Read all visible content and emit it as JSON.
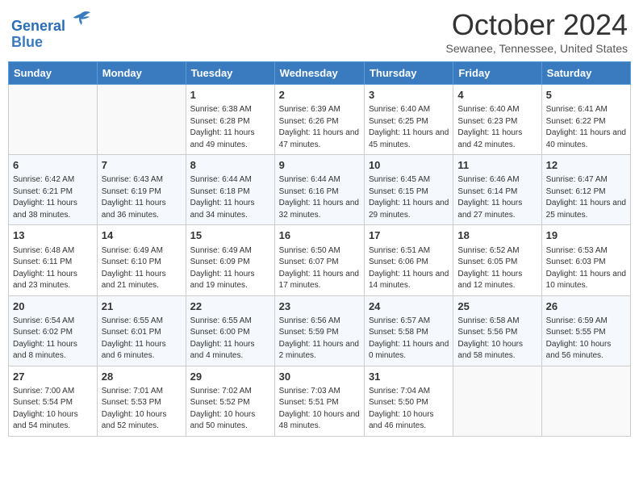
{
  "header": {
    "logo_line1": "General",
    "logo_line2": "Blue",
    "month_title": "October 2024",
    "location": "Sewanee, Tennessee, United States"
  },
  "days_of_week": [
    "Sunday",
    "Monday",
    "Tuesday",
    "Wednesday",
    "Thursday",
    "Friday",
    "Saturday"
  ],
  "weeks": [
    [
      {
        "day": "",
        "info": ""
      },
      {
        "day": "",
        "info": ""
      },
      {
        "day": "1",
        "info": "Sunrise: 6:38 AM\nSunset: 6:28 PM\nDaylight: 11 hours and 49 minutes."
      },
      {
        "day": "2",
        "info": "Sunrise: 6:39 AM\nSunset: 6:26 PM\nDaylight: 11 hours and 47 minutes."
      },
      {
        "day": "3",
        "info": "Sunrise: 6:40 AM\nSunset: 6:25 PM\nDaylight: 11 hours and 45 minutes."
      },
      {
        "day": "4",
        "info": "Sunrise: 6:40 AM\nSunset: 6:23 PM\nDaylight: 11 hours and 42 minutes."
      },
      {
        "day": "5",
        "info": "Sunrise: 6:41 AM\nSunset: 6:22 PM\nDaylight: 11 hours and 40 minutes."
      }
    ],
    [
      {
        "day": "6",
        "info": "Sunrise: 6:42 AM\nSunset: 6:21 PM\nDaylight: 11 hours and 38 minutes."
      },
      {
        "day": "7",
        "info": "Sunrise: 6:43 AM\nSunset: 6:19 PM\nDaylight: 11 hours and 36 minutes."
      },
      {
        "day": "8",
        "info": "Sunrise: 6:44 AM\nSunset: 6:18 PM\nDaylight: 11 hours and 34 minutes."
      },
      {
        "day": "9",
        "info": "Sunrise: 6:44 AM\nSunset: 6:16 PM\nDaylight: 11 hours and 32 minutes."
      },
      {
        "day": "10",
        "info": "Sunrise: 6:45 AM\nSunset: 6:15 PM\nDaylight: 11 hours and 29 minutes."
      },
      {
        "day": "11",
        "info": "Sunrise: 6:46 AM\nSunset: 6:14 PM\nDaylight: 11 hours and 27 minutes."
      },
      {
        "day": "12",
        "info": "Sunrise: 6:47 AM\nSunset: 6:12 PM\nDaylight: 11 hours and 25 minutes."
      }
    ],
    [
      {
        "day": "13",
        "info": "Sunrise: 6:48 AM\nSunset: 6:11 PM\nDaylight: 11 hours and 23 minutes."
      },
      {
        "day": "14",
        "info": "Sunrise: 6:49 AM\nSunset: 6:10 PM\nDaylight: 11 hours and 21 minutes."
      },
      {
        "day": "15",
        "info": "Sunrise: 6:49 AM\nSunset: 6:09 PM\nDaylight: 11 hours and 19 minutes."
      },
      {
        "day": "16",
        "info": "Sunrise: 6:50 AM\nSunset: 6:07 PM\nDaylight: 11 hours and 17 minutes."
      },
      {
        "day": "17",
        "info": "Sunrise: 6:51 AM\nSunset: 6:06 PM\nDaylight: 11 hours and 14 minutes."
      },
      {
        "day": "18",
        "info": "Sunrise: 6:52 AM\nSunset: 6:05 PM\nDaylight: 11 hours and 12 minutes."
      },
      {
        "day": "19",
        "info": "Sunrise: 6:53 AM\nSunset: 6:03 PM\nDaylight: 11 hours and 10 minutes."
      }
    ],
    [
      {
        "day": "20",
        "info": "Sunrise: 6:54 AM\nSunset: 6:02 PM\nDaylight: 11 hours and 8 minutes."
      },
      {
        "day": "21",
        "info": "Sunrise: 6:55 AM\nSunset: 6:01 PM\nDaylight: 11 hours and 6 minutes."
      },
      {
        "day": "22",
        "info": "Sunrise: 6:55 AM\nSunset: 6:00 PM\nDaylight: 11 hours and 4 minutes."
      },
      {
        "day": "23",
        "info": "Sunrise: 6:56 AM\nSunset: 5:59 PM\nDaylight: 11 hours and 2 minutes."
      },
      {
        "day": "24",
        "info": "Sunrise: 6:57 AM\nSunset: 5:58 PM\nDaylight: 11 hours and 0 minutes."
      },
      {
        "day": "25",
        "info": "Sunrise: 6:58 AM\nSunset: 5:56 PM\nDaylight: 10 hours and 58 minutes."
      },
      {
        "day": "26",
        "info": "Sunrise: 6:59 AM\nSunset: 5:55 PM\nDaylight: 10 hours and 56 minutes."
      }
    ],
    [
      {
        "day": "27",
        "info": "Sunrise: 7:00 AM\nSunset: 5:54 PM\nDaylight: 10 hours and 54 minutes."
      },
      {
        "day": "28",
        "info": "Sunrise: 7:01 AM\nSunset: 5:53 PM\nDaylight: 10 hours and 52 minutes."
      },
      {
        "day": "29",
        "info": "Sunrise: 7:02 AM\nSunset: 5:52 PM\nDaylight: 10 hours and 50 minutes."
      },
      {
        "day": "30",
        "info": "Sunrise: 7:03 AM\nSunset: 5:51 PM\nDaylight: 10 hours and 48 minutes."
      },
      {
        "day": "31",
        "info": "Sunrise: 7:04 AM\nSunset: 5:50 PM\nDaylight: 10 hours and 46 minutes."
      },
      {
        "day": "",
        "info": ""
      },
      {
        "day": "",
        "info": ""
      }
    ]
  ]
}
